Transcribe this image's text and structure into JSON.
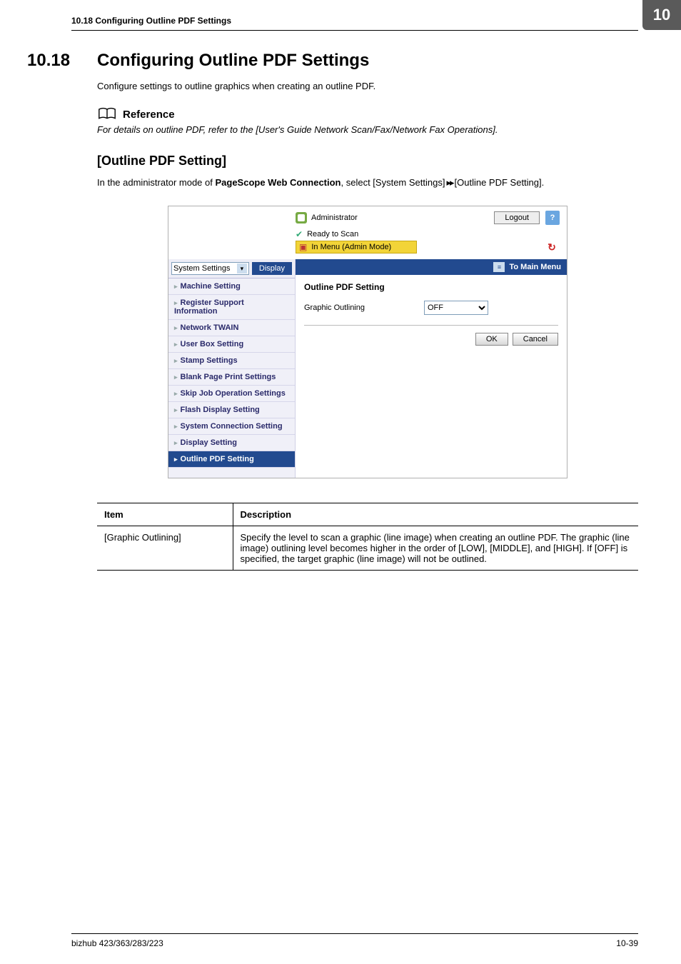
{
  "page": {
    "chapter_number": "10",
    "running_head": "10.18   Configuring Outline PDF Settings",
    "section_number": "10.18",
    "section_title": "Configuring Outline PDF Settings",
    "lead": "Configure settings to outline graphics when creating an outline PDF.",
    "reference_label": "Reference",
    "reference_text": "For details on outline PDF, refer to the [User's Guide Network Scan/Fax/Network Fax Operations].",
    "sub_title": "[Outline PDF Setting]",
    "admin_line_prefix": "In the administrator mode of ",
    "admin_line_bold": "PageScope Web Connection",
    "admin_line_mid": ", select [System Settings]",
    "admin_line_suffix": "[Outline PDF Setting].",
    "arrows": "▸▸"
  },
  "screenshot": {
    "role": "Administrator",
    "logout": "Logout",
    "help": "?",
    "status_ready": "Ready to Scan",
    "status_menu": "In Menu (Admin Mode)",
    "refresh_glyph": "↻",
    "sidebar_select": "System Settings",
    "display_btn": "Display",
    "to_main_menu": "To Main Menu",
    "panel_title": "Outline PDF Setting",
    "graphic_label": "Graphic Outlining",
    "graphic_value": "OFF",
    "ok": "OK",
    "cancel": "Cancel",
    "sidebar": [
      "Machine Setting",
      "Register Support Information",
      "Network TWAIN",
      "User Box Setting",
      "Stamp Settings",
      "Blank Page Print Settings",
      "Skip Job Operation Settings",
      "Flash Display Setting",
      "System Connection Setting",
      "Display Setting",
      "Outline PDF Setting"
    ]
  },
  "table": {
    "head_item": "Item",
    "head_desc": "Description",
    "row_item": "[Graphic Outlining]",
    "row_desc": "Specify the level to scan a graphic (line image) when creating an outline PDF. The graphic (line image) outlining level becomes higher in the order of [LOW], [MIDDLE], and [HIGH]. If [OFF] is specified, the target graphic (line image) will not be outlined."
  },
  "footer": {
    "model": "bizhub 423/363/283/223",
    "pagenum": "10-39"
  }
}
